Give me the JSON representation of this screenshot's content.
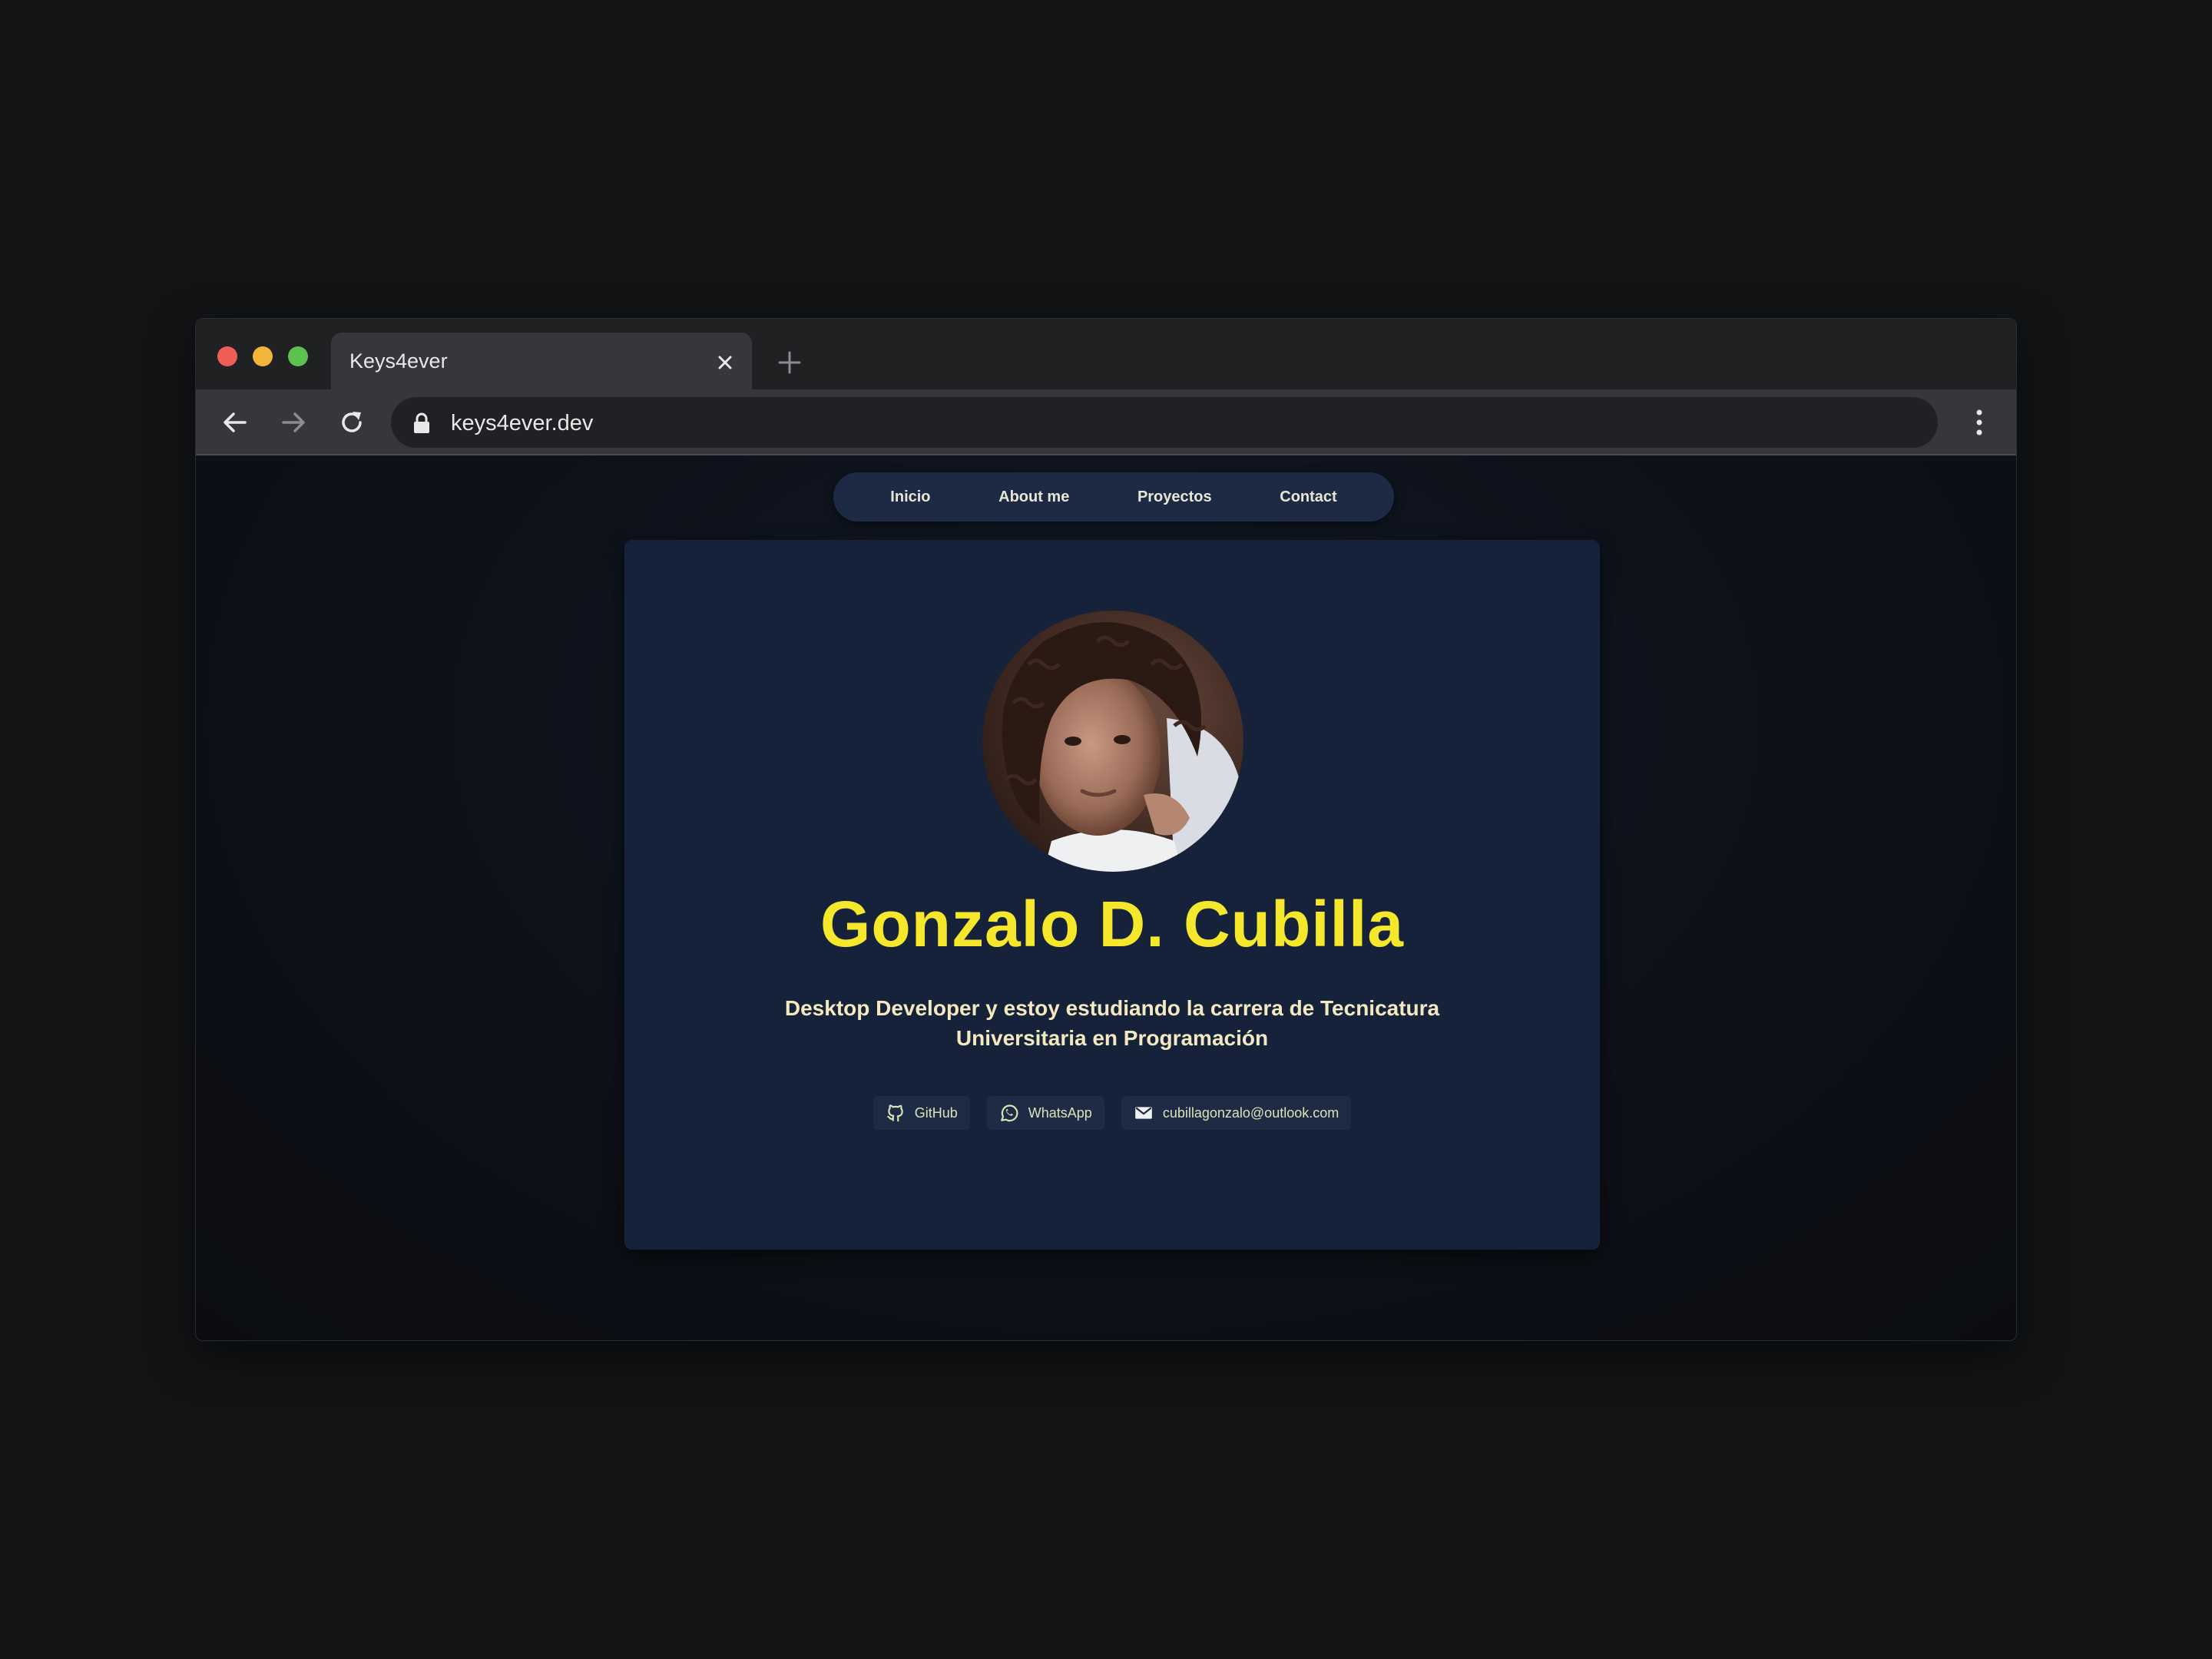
{
  "browser": {
    "tab_title": "Keys4ever",
    "url": "keys4ever.dev"
  },
  "site": {
    "nav": [
      "Inicio",
      "About me",
      "Proyectos",
      "Contact"
    ],
    "name": "Gonzalo D. Cubilla",
    "subtitle": "Desktop Developer y estoy estudiando la carrera de Tecnicatura Universitaria en Programación",
    "links": {
      "github": "GitHub",
      "whatsapp": "WhatsApp",
      "email": "cubillagonzalo@outlook.com"
    },
    "colors": {
      "name": "#f5e72b",
      "card": "#16213a",
      "nav": "#1d2a44"
    }
  }
}
